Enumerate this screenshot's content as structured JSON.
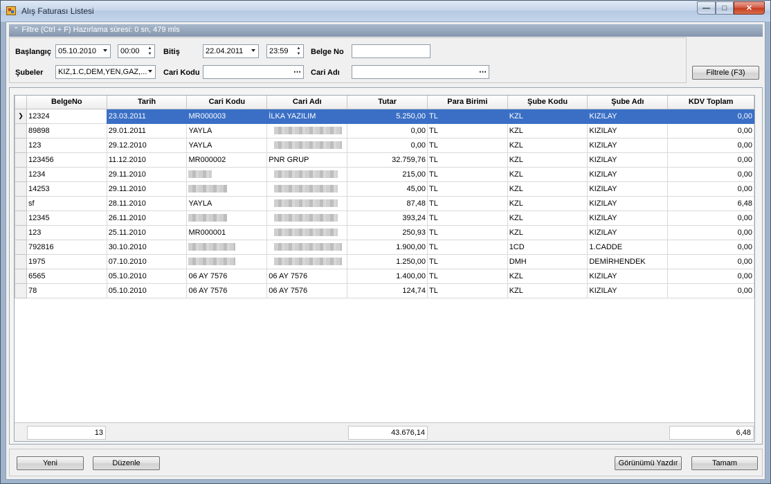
{
  "window": {
    "title": "Alış Faturası Listesi"
  },
  "filter": {
    "header": "Filtre (Ctrl + F) Hazırlama süresi: 0 sn, 479 mls",
    "baslangic_label": "Başlangıç",
    "baslangic_date": "05.10.2010",
    "baslangic_time": "00:00",
    "bitis_label": "Bitiş",
    "bitis_date": "22.04.2011",
    "bitis_time": "23:59",
    "belge_no_label": "Belge No",
    "belge_no_value": "",
    "subeler_label": "Şubeler",
    "subeler_value": "KIZ,1.C,DEM,YEN,GAZ,...",
    "cari_kodu_label": "Cari Kodu",
    "cari_kodu_value": "",
    "cari_adi_label": "Cari Adı",
    "cari_adi_value": "",
    "filter_button": "Filtrele (F3)"
  },
  "grid": {
    "columns": [
      "BelgeNo",
      "Tarih",
      "Cari Kodu",
      "Cari Adı",
      "Tutar",
      "Para Birimi",
      "Şube Kodu",
      "Şube Adı",
      "KDV Toplam"
    ],
    "rows": [
      {
        "belge_no": "12324",
        "tarih": "23.03.2011",
        "cari_kodu": "MR000003",
        "cari_adi": "İLKA YAZILIM",
        "tutar": "5.250,00",
        "para": "TL",
        "sube_kodu": "KZL",
        "sube_adi": "KIZILAY",
        "kdv": "0,00"
      },
      {
        "belge_no": "89898",
        "tarih": "29.01.2011",
        "cari_kodu": "YAYLA",
        "cari_adi": "",
        "tutar": "0,00",
        "para": "TL",
        "sube_kodu": "KZL",
        "sube_adi": "KIZILAY",
        "kdv": "0,00"
      },
      {
        "belge_no": "123",
        "tarih": "29.12.2010",
        "cari_kodu": "YAYLA",
        "cari_adi": "",
        "tutar": "0,00",
        "para": "TL",
        "sube_kodu": "KZL",
        "sube_adi": "KIZILAY",
        "kdv": "0,00"
      },
      {
        "belge_no": "123456",
        "tarih": "11.12.2010",
        "cari_kodu": "MR000002",
        "cari_adi": "PNR GRUP",
        "tutar": "32.759,76",
        "para": "TL",
        "sube_kodu": "KZL",
        "sube_adi": "KIZILAY",
        "kdv": "0,00"
      },
      {
        "belge_no": "1234",
        "tarih": "29.11.2010",
        "cari_kodu": "",
        "cari_adi": "",
        "tutar": "215,00",
        "para": "TL",
        "sube_kodu": "KZL",
        "sube_adi": "KIZILAY",
        "kdv": "0,00"
      },
      {
        "belge_no": "14253",
        "tarih": "29.11.2010",
        "cari_kodu": "",
        "cari_adi": "",
        "tutar": "45,00",
        "para": "TL",
        "sube_kodu": "KZL",
        "sube_adi": "KIZILAY",
        "kdv": "0,00"
      },
      {
        "belge_no": "sf",
        "tarih": "28.11.2010",
        "cari_kodu": "YAYLA",
        "cari_adi": "",
        "tutar": "87,48",
        "para": "TL",
        "sube_kodu": "KZL",
        "sube_adi": "KIZILAY",
        "kdv": "6,48"
      },
      {
        "belge_no": "12345",
        "tarih": "26.11.2010",
        "cari_kodu": "",
        "cari_adi": "",
        "tutar": "393,24",
        "para": "TL",
        "sube_kodu": "KZL",
        "sube_adi": "KIZILAY",
        "kdv": "0,00"
      },
      {
        "belge_no": "123",
        "tarih": "25.11.2010",
        "cari_kodu": "MR000001",
        "cari_adi": "",
        "tutar": "250,93",
        "para": "TL",
        "sube_kodu": "KZL",
        "sube_adi": "KIZILAY",
        "kdv": "0,00"
      },
      {
        "belge_no": "792816",
        "tarih": "30.10.2010",
        "cari_kodu": "",
        "cari_adi": "",
        "tutar": "1.900,00",
        "para": "TL",
        "sube_kodu": "1CD",
        "sube_adi": "1.CADDE",
        "kdv": "0,00"
      },
      {
        "belge_no": "1975",
        "tarih": "07.10.2010",
        "cari_kodu": "",
        "cari_adi": "",
        "tutar": "1.250,00",
        "para": "TL",
        "sube_kodu": "DMH",
        "sube_adi": "DEMİRHENDEK",
        "kdv": "0,00"
      },
      {
        "belge_no": "6565",
        "tarih": "05.10.2010",
        "cari_kodu": "06 AY 7576",
        "cari_adi": "06 AY 7576",
        "tutar": "1.400,00",
        "para": "TL",
        "sube_kodu": "KZL",
        "sube_adi": "KIZILAY",
        "kdv": "0,00"
      },
      {
        "belge_no": "78",
        "tarih": "05.10.2010",
        "cari_kodu": "06 AY 7576",
        "cari_adi": "06 AY 7576",
        "tutar": "124,74",
        "para": "TL",
        "sube_kodu": "KZL",
        "sube_adi": "KIZILAY",
        "kdv": "0,00"
      }
    ],
    "redacted_cari_kodu": [
      false,
      false,
      false,
      false,
      true,
      true,
      false,
      true,
      false,
      true,
      true,
      false,
      false
    ],
    "redacted_cari_adi": [
      false,
      true,
      true,
      false,
      true,
      true,
      true,
      true,
      true,
      true,
      true,
      false,
      false
    ],
    "summary": {
      "count": "13",
      "tutar_total": "43.676,14",
      "kdv_total": "6,48"
    }
  },
  "buttons": {
    "yeni": "Yeni",
    "duzenle": "Düzenle",
    "print_view": "Görünümü Yazdır",
    "ok": "Tamam"
  }
}
